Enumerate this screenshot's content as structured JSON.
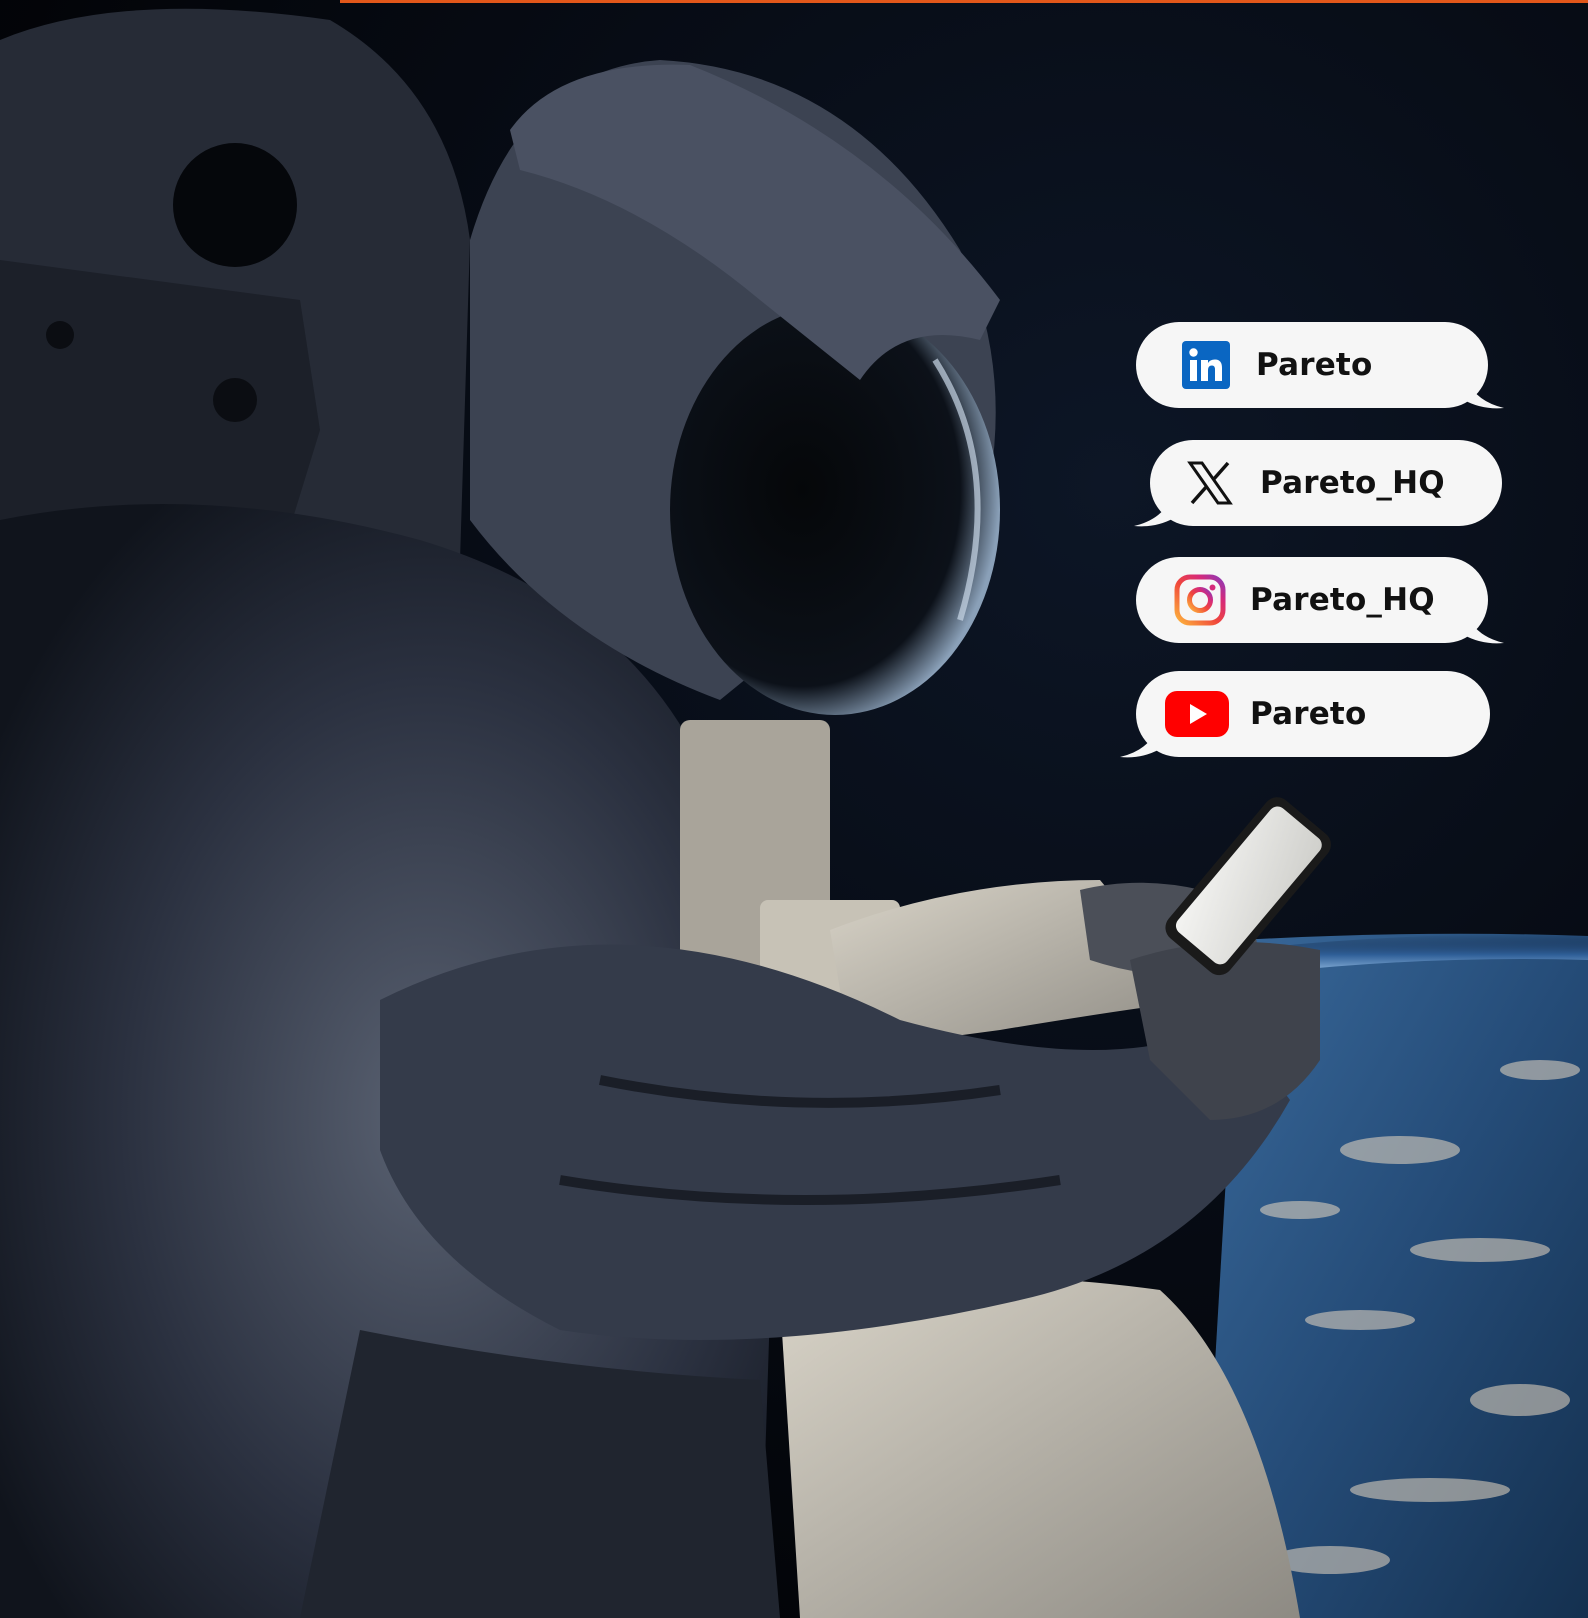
{
  "background": {
    "subject": "astronaut holding smartphone above earth",
    "colors": {
      "space": "#05080d",
      "atmosphere": "#4a7fb8",
      "suit": "#3b4150",
      "accent": "#e2571a"
    }
  },
  "socials": [
    {
      "platform": "linkedin",
      "icon": "linkedin-icon",
      "handle": "Pareto",
      "color": "#0a66c2"
    },
    {
      "platform": "x",
      "icon": "x-icon",
      "handle": "Pareto_HQ",
      "color": "#000000"
    },
    {
      "platform": "instagram",
      "icon": "instagram-icon",
      "handle": "Pareto_HQ",
      "color": "#e1306c"
    },
    {
      "platform": "youtube",
      "icon": "youtube-icon",
      "handle": "Pareto",
      "color": "#ff0000"
    }
  ]
}
